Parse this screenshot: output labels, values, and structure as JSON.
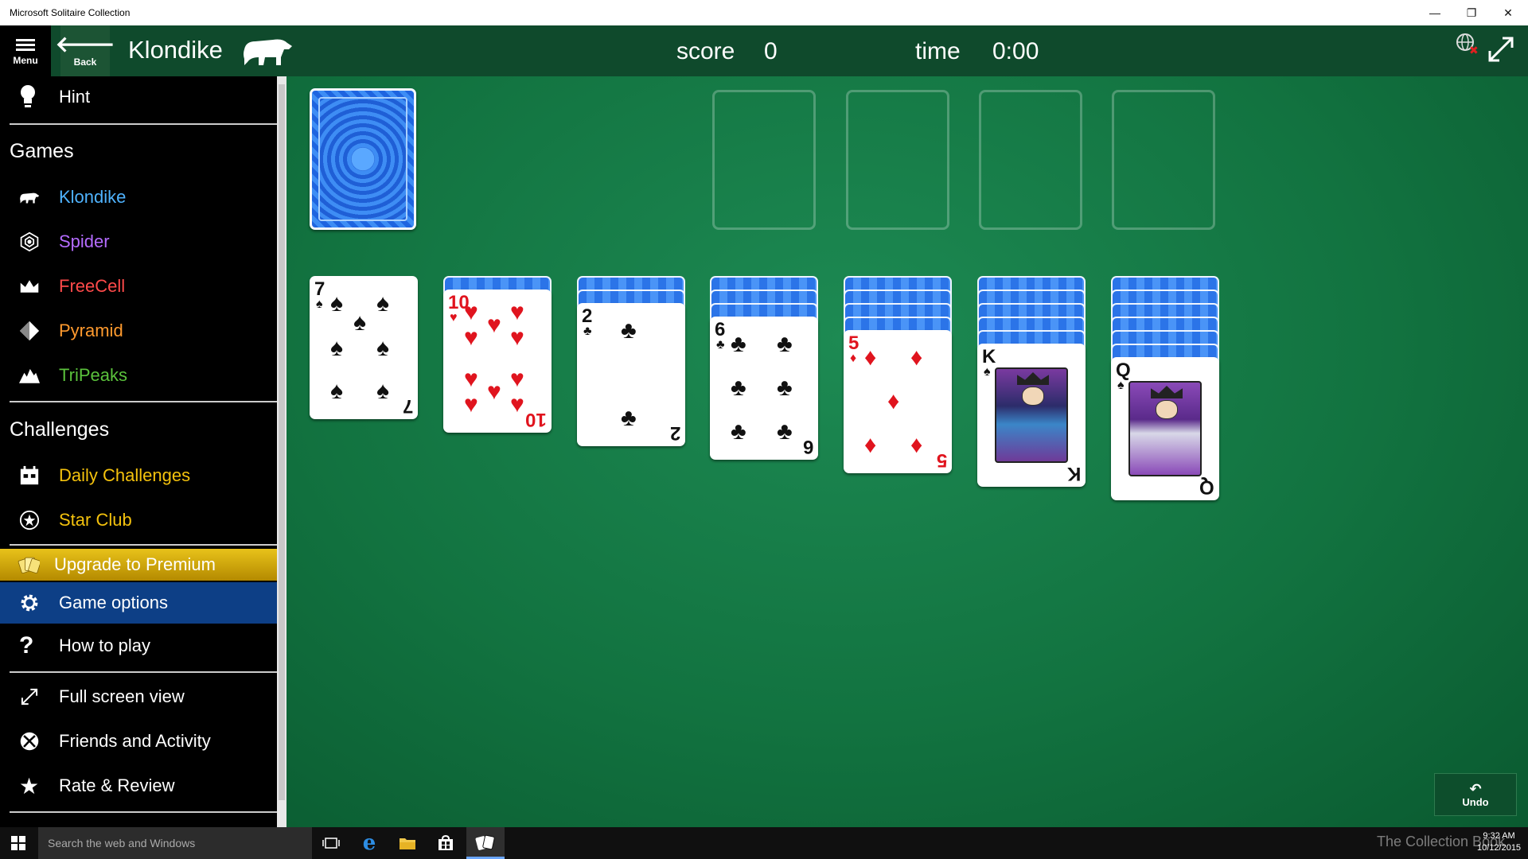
{
  "window": {
    "title": "Microsoft Solitaire Collection",
    "controls": {
      "minimize": "—",
      "restore": "❐",
      "close": "✕"
    }
  },
  "header": {
    "menu_label": "Menu",
    "back_label": "Back",
    "game_title": "Klondike",
    "score_label": "score",
    "score_value": "0",
    "time_label": "time",
    "time_value": "0:00"
  },
  "sidebar": {
    "hint": "Hint",
    "games_heading": "Games",
    "games": [
      {
        "label": "Klondike",
        "color": "#4fb3ff",
        "icon": "bear-icon"
      },
      {
        "label": "Spider",
        "color": "#b56cff",
        "icon": "spider-icon"
      },
      {
        "label": "FreeCell",
        "color": "#ff4a4a",
        "icon": "crown-icon"
      },
      {
        "label": "Pyramid",
        "color": "#ff9a2e",
        "icon": "pyramid-icon"
      },
      {
        "label": "TriPeaks",
        "color": "#5bc23c",
        "icon": "peaks-icon"
      }
    ],
    "challenges_heading": "Challenges",
    "challenges": [
      {
        "label": "Daily Challenges",
        "color": "#f4c20d",
        "icon": "calendar-icon"
      },
      {
        "label": "Star Club",
        "color": "#f4c20d",
        "icon": "star-club-icon"
      }
    ],
    "premium": "Upgrade to Premium",
    "game_options": "Game options",
    "how_to_play": "How to play",
    "full_screen": "Full screen view",
    "friends": "Friends and Activity",
    "rate": "Rate & Review"
  },
  "board": {
    "undo_label": "Undo",
    "tableau": [
      {
        "rank": "7",
        "suit": "♠",
        "color": "black",
        "face_down": 0
      },
      {
        "rank": "10",
        "suit": "♥",
        "color": "red",
        "face_down": 1
      },
      {
        "rank": "2",
        "suit": "♣",
        "color": "black",
        "face_down": 2
      },
      {
        "rank": "6",
        "suit": "♣",
        "color": "black",
        "face_down": 3
      },
      {
        "rank": "5",
        "suit": "♦",
        "color": "red",
        "face_down": 4
      },
      {
        "rank": "K",
        "suit": "♠",
        "color": "black",
        "face_down": 5
      },
      {
        "rank": "Q",
        "suit": "♠",
        "color": "black",
        "face_down": 6
      }
    ]
  },
  "taskbar": {
    "search_placeholder": "Search the web and Windows",
    "watermark": "The Collection Book",
    "time": "9:32 AM",
    "date": "10/12/2015"
  }
}
